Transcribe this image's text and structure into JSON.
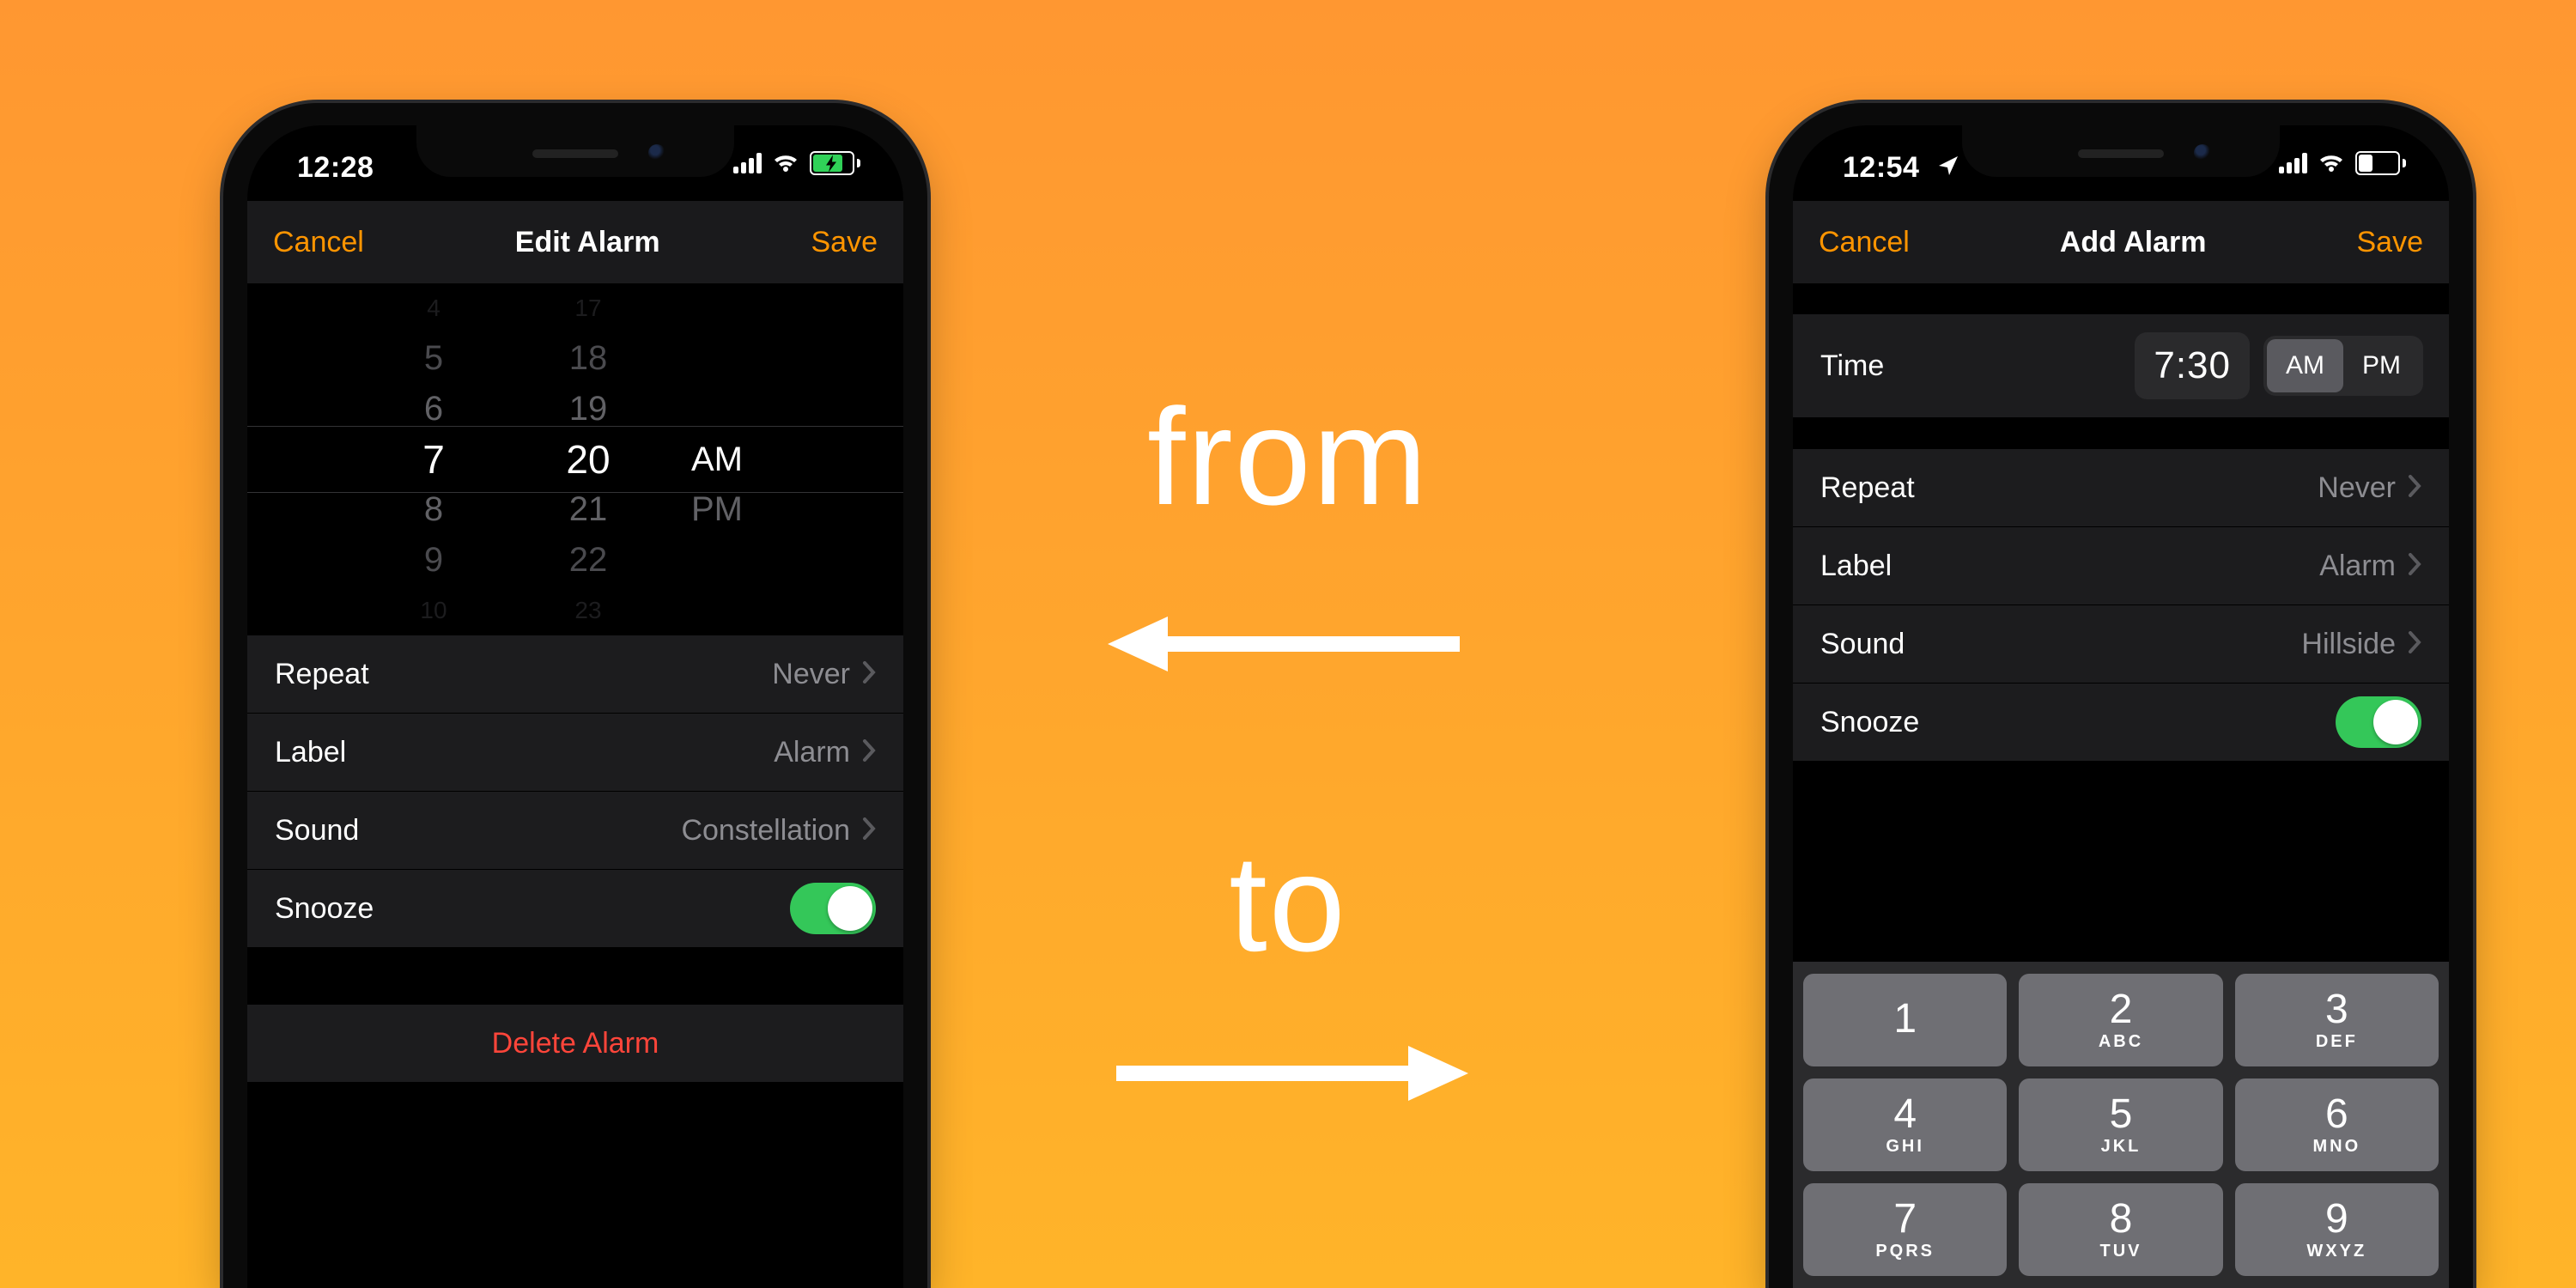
{
  "annotation": {
    "from": "from",
    "to": "to"
  },
  "left": {
    "status": {
      "time": "12:28"
    },
    "nav": {
      "cancel": "Cancel",
      "title": "Edit Alarm",
      "save": "Save"
    },
    "picker": {
      "hours": [
        "4",
        "5",
        "6",
        "7",
        "8",
        "9",
        "10"
      ],
      "minutes": [
        "17",
        "18",
        "19",
        "20",
        "21",
        "22",
        "23"
      ],
      "ampm": [
        "AM",
        "PM"
      ],
      "selected": {
        "hour": "7",
        "minute": "20",
        "ampm": "AM"
      }
    },
    "settings": {
      "repeat": {
        "label": "Repeat",
        "value": "Never"
      },
      "label": {
        "label": "Label",
        "value": "Alarm"
      },
      "sound": {
        "label": "Sound",
        "value": "Constellation"
      },
      "snooze": {
        "label": "Snooze",
        "on": true
      }
    },
    "delete": "Delete Alarm"
  },
  "right": {
    "status": {
      "time": "12:54"
    },
    "nav": {
      "cancel": "Cancel",
      "title": "Add Alarm",
      "save": "Save"
    },
    "time": {
      "label": "Time",
      "value": "7:30",
      "am": "AM",
      "pm": "PM",
      "selected": "AM"
    },
    "settings": {
      "repeat": {
        "label": "Repeat",
        "value": "Never"
      },
      "label": {
        "label": "Label",
        "value": "Alarm"
      },
      "sound": {
        "label": "Sound",
        "value": "Hillside"
      },
      "snooze": {
        "label": "Snooze",
        "on": true
      }
    },
    "keypad": [
      {
        "n": "1",
        "l": ""
      },
      {
        "n": "2",
        "l": "ABC"
      },
      {
        "n": "3",
        "l": "DEF"
      },
      {
        "n": "4",
        "l": "GHI"
      },
      {
        "n": "5",
        "l": "JKL"
      },
      {
        "n": "6",
        "l": "MNO"
      },
      {
        "n": "7",
        "l": "PQRS"
      },
      {
        "n": "8",
        "l": "TUV"
      },
      {
        "n": "9",
        "l": "WXYZ"
      }
    ]
  }
}
